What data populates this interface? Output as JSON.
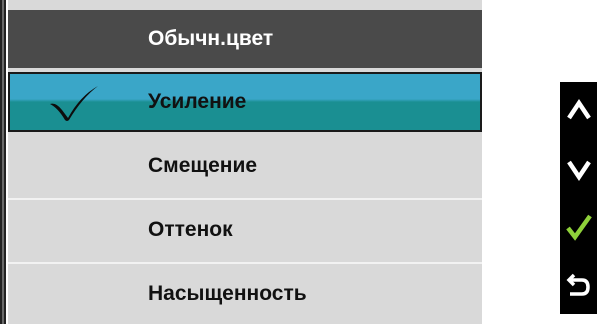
{
  "menu": {
    "header": "Обычн.цвет",
    "items": [
      {
        "label": "Усиление",
        "selected": true
      },
      {
        "label": "Смещение",
        "selected": false
      },
      {
        "label": "Оттенок",
        "selected": false
      },
      {
        "label": "Насыщенность",
        "selected": false
      }
    ]
  },
  "button_guide": {
    "buttons": [
      "chevron-up-icon",
      "chevron-down-icon",
      "check-icon",
      "back-icon"
    ]
  },
  "colors": {
    "selected_top": "#3aa6c8",
    "selected_bottom": "#1a8f92",
    "check_green": "#8fd13a",
    "header_bg": "#4a4a4a",
    "item_bg": "#d9d9d9"
  }
}
